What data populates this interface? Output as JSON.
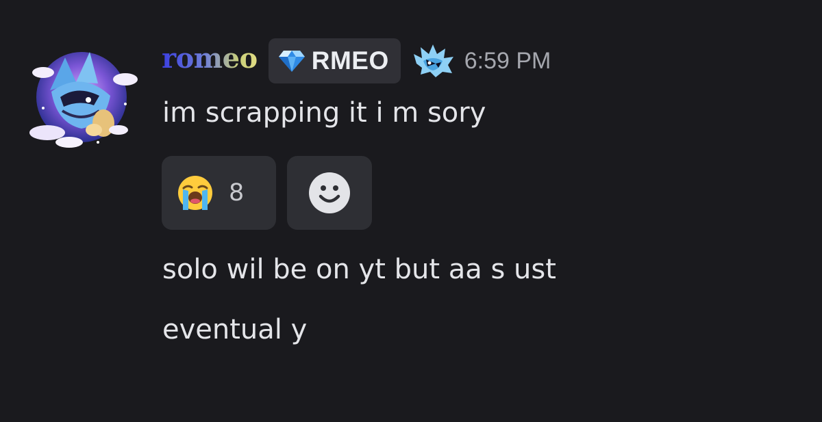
{
  "message": {
    "author": {
      "username": "romeo",
      "tag": "RMEO",
      "avatar_icon": "character-avatar-icon",
      "tag_icon": "diamond-icon",
      "decoration_icon": "blue-creature-icon"
    },
    "timestamp": "6:59 PM",
    "lines": [
      "im scrapping it i m sory",
      "solo wil be on yt but aa s ust",
      "eventual y"
    ],
    "reactions": [
      {
        "emoji": "loudly-crying-face-icon",
        "count": "8"
      }
    ],
    "add_reaction_icon": "smiley-icon"
  },
  "colors": {
    "background": "#1a1a1e",
    "text": "#e4e5e9",
    "timestamp": "#a5a7ae",
    "tag_bg": "#303036",
    "reaction_bg": "#2e2f34",
    "username_gradient": [
      "#3b3fe0",
      "#6f7fd8",
      "#c9cf7a",
      "#e2dd84"
    ]
  }
}
